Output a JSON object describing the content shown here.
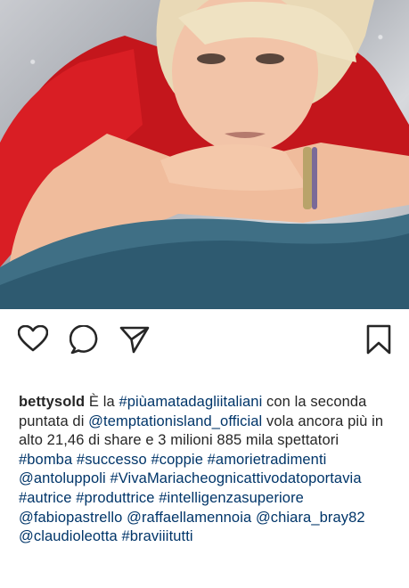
{
  "post": {
    "username": "bettysold",
    "caption_parts": [
      {
        "type": "text",
        "value": " È la "
      },
      {
        "type": "tag",
        "value": "#piùamatadagliitaliani"
      },
      {
        "type": "text",
        "value": " con la seconda puntata di "
      },
      {
        "type": "tag",
        "value": "@temptationisland_official"
      },
      {
        "type": "text",
        "value": " vola ancora più in alto 21,46 di share e 3 milioni 885 mila spettatori "
      },
      {
        "type": "tag",
        "value": "#bomba"
      },
      {
        "type": "text",
        "value": " "
      },
      {
        "type": "tag",
        "value": "#successo"
      },
      {
        "type": "text",
        "value": " "
      },
      {
        "type": "tag",
        "value": "#coppie"
      },
      {
        "type": "text",
        "value": " "
      },
      {
        "type": "tag",
        "value": "#amorietradimenti"
      },
      {
        "type": "text",
        "value": " "
      },
      {
        "type": "tag",
        "value": "@antoluppoli"
      },
      {
        "type": "text",
        "value": " "
      },
      {
        "type": "tag",
        "value": "#VivaMariacheognicattivodatoportavia"
      },
      {
        "type": "text",
        "value": " "
      },
      {
        "type": "tag",
        "value": "#autrice"
      },
      {
        "type": "text",
        "value": " "
      },
      {
        "type": "tag",
        "value": "#produttrice"
      },
      {
        "type": "text",
        "value": " "
      },
      {
        "type": "tag",
        "value": "#intelligenzasuperiore"
      },
      {
        "type": "text",
        "value": " "
      },
      {
        "type": "tag",
        "value": "@fabiopastrello"
      },
      {
        "type": "text",
        "value": " "
      },
      {
        "type": "tag",
        "value": "@raffaellamennoia"
      },
      {
        "type": "text",
        "value": " "
      },
      {
        "type": "tag",
        "value": "@chiara_bray82"
      },
      {
        "type": "text",
        "value": " "
      },
      {
        "type": "tag",
        "value": "@claudioleotta"
      },
      {
        "type": "text",
        "value": " "
      },
      {
        "type": "tag",
        "value": "#braviiitutti"
      }
    ]
  },
  "actions": {
    "icons": [
      "heart-icon",
      "comment-icon",
      "share-icon",
      "bookmark-icon"
    ]
  },
  "colors": {
    "text": "#262626",
    "link": "#003569",
    "background": "#ffffff"
  }
}
